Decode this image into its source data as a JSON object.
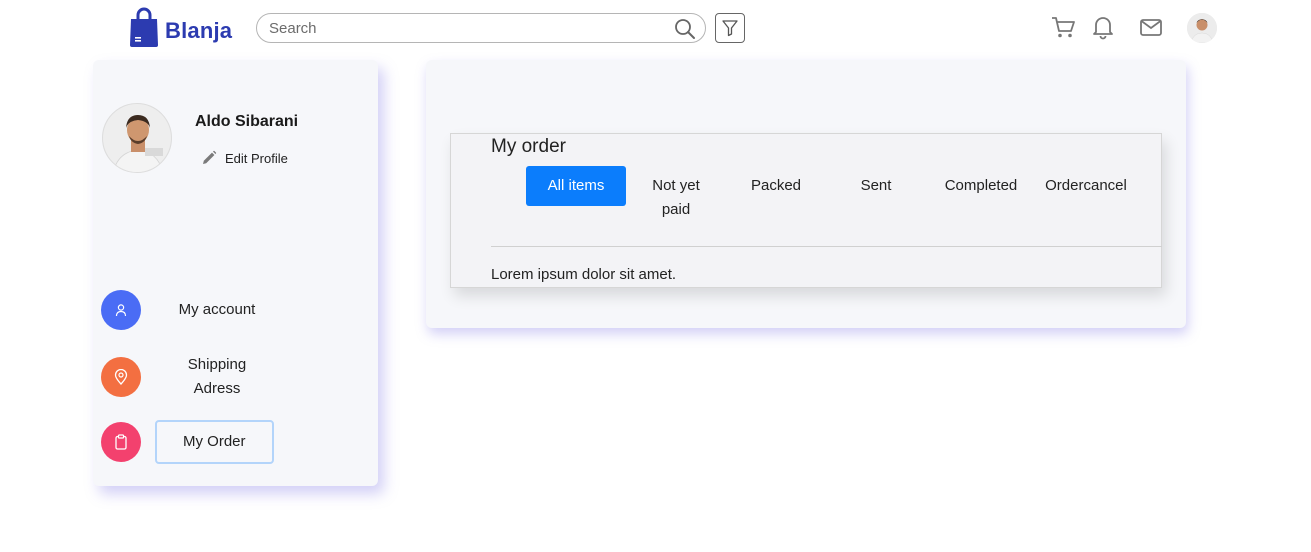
{
  "header": {
    "brand": "Blanja",
    "search_placeholder": "Search",
    "icons": [
      "cart-icon",
      "bell-icon",
      "mail-icon"
    ]
  },
  "sidebar": {
    "user_name": "Aldo Sibarani",
    "edit_profile_label": "Edit Profile",
    "items": [
      {
        "label": "My account",
        "icon": "user-icon",
        "color": "#4a6cf5"
      },
      {
        "label": "Shipping Adress",
        "icon": "location-pin-icon",
        "color": "#f36f41"
      },
      {
        "label": "My Order",
        "icon": "clipboard-icon",
        "color": "#f3416e"
      }
    ]
  },
  "order": {
    "title": "My order",
    "tabs": [
      "All items",
      "Not yet paid",
      "Packed",
      "Sent",
      "Completed",
      "Ordercancel"
    ],
    "active_tab": "All items",
    "body_text": "Lorem ipsum dolor sit amet."
  },
  "colors": {
    "brand": "#2c3bb0",
    "active_tab": "#0b7dfc"
  }
}
